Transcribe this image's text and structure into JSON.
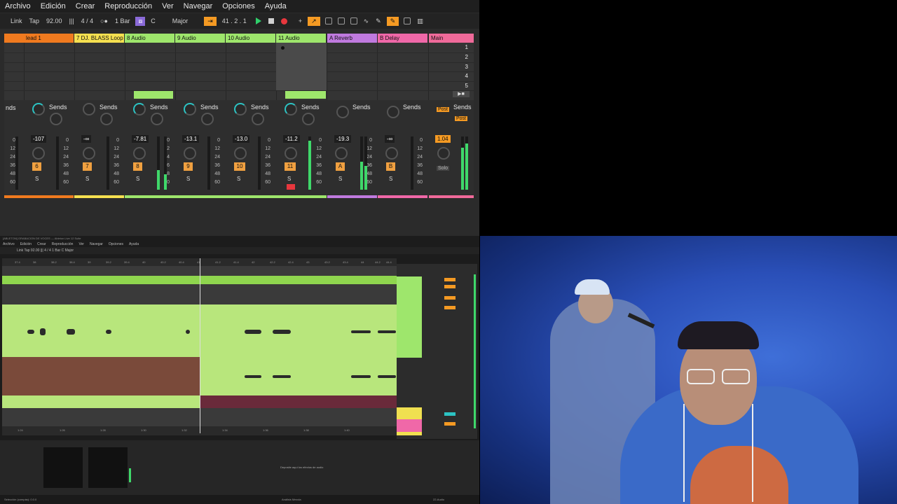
{
  "menu": [
    "Archivo",
    "Edición",
    "Crear",
    "Reproducción",
    "Ver",
    "Navegar",
    "Opciones",
    "Ayuda"
  ],
  "control_bar": {
    "link": "Link",
    "tap": "Tap",
    "tempo": "92.00",
    "signature": "4 / 4",
    "quantize": "1 Bar",
    "key": "C",
    "scale": "Major",
    "position": "41 . 2 . 1"
  },
  "tracks": [
    {
      "name": "lead 1",
      "color": "#f07a1f",
      "num": "6"
    },
    {
      "name": "7 DJ. BLASS  Loop",
      "color": "#f5e050",
      "num": "7"
    },
    {
      "name": "8 Audio",
      "color": "#9ee66c",
      "num": "8"
    },
    {
      "name": "9 Audio",
      "color": "#9ee66c",
      "num": "9"
    },
    {
      "name": "10 Audio",
      "color": "#9ee66c",
      "num": "10"
    },
    {
      "name": "11 Audio",
      "color": "#9ee66c",
      "num": "11"
    },
    {
      "name": "A Reverb",
      "color": "#c07adf",
      "num": "A"
    },
    {
      "name": "B Delay",
      "color": "#f068a8",
      "num": "B"
    },
    {
      "name": "Main",
      "color": "#f06a9a",
      "num": ""
    }
  ],
  "scenes": [
    "1",
    "2",
    "3",
    "4",
    "5"
  ],
  "mixer": {
    "sends_label": "Sends",
    "send_a": "A",
    "send_b": "B",
    "sends_partial": "nds",
    "post": "Post",
    "solo": "Solo",
    "s": "S",
    "volumes": [
      "-107",
      "-∞",
      "-7.81",
      "-13.1",
      "-13.0",
      "-11.2",
      "-19.3",
      "-∞",
      "1.04"
    ],
    "scale_marks": [
      "0",
      "12",
      "24",
      "36",
      "48",
      "60"
    ]
  },
  "bottom_window": {
    "title": "[ABLETON] GRABACION DE VOCES — Ableton Live 12 Suite",
    "menu": [
      "Archivo",
      "Edición",
      "Crear",
      "Reproducción",
      "Ver",
      "Navegar",
      "Opciones",
      "Ayuda"
    ],
    "ctrl": "Link  Tap  92.00  ||| 4 / 4  1 Bar   C   Major",
    "ruler_ticks": [
      "37.4",
      "38",
      "38.2",
      "38.4",
      "39",
      "39.2",
      "39.4",
      "40",
      "40.2",
      "40.4",
      "41",
      "41.2",
      "41.4",
      "42",
      "42.2",
      "42.4",
      "43",
      "43.2",
      "43.4",
      "44",
      "44.2",
      "44.4"
    ],
    "time_ticks": [
      "1:24",
      "1:26",
      "1:28",
      "1:30",
      "1:32",
      "1:34",
      "1:36",
      "1:38",
      "1:40"
    ],
    "drop_hint": "Deposite aquí los efectos de audio",
    "status_left": "Selección (compás): 0.0.0",
    "status_mid": "Análisis Mezcla",
    "status_right": "22-Audio"
  },
  "colors": {
    "clip_green": "#9ee66c",
    "orange": "#f59a23",
    "brown_clip": "#7a4a3a",
    "maroon_clip": "#6a2a3a"
  }
}
